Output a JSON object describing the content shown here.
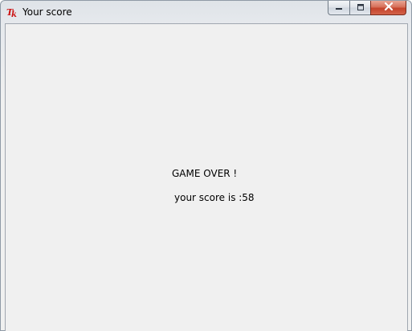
{
  "window": {
    "title": "Your score",
    "icon": "tk-feather-icon",
    "buttons": {
      "minimize_icon": "minimize-icon",
      "maximize_icon": "maximize-icon",
      "close_icon": "close-icon"
    }
  },
  "content": {
    "heading": "GAME OVER !",
    "score_text": "your score is :58"
  },
  "colors": {
    "close_button": "#c4432b",
    "client_background": "#f0f0f0",
    "text": "#000000"
  }
}
